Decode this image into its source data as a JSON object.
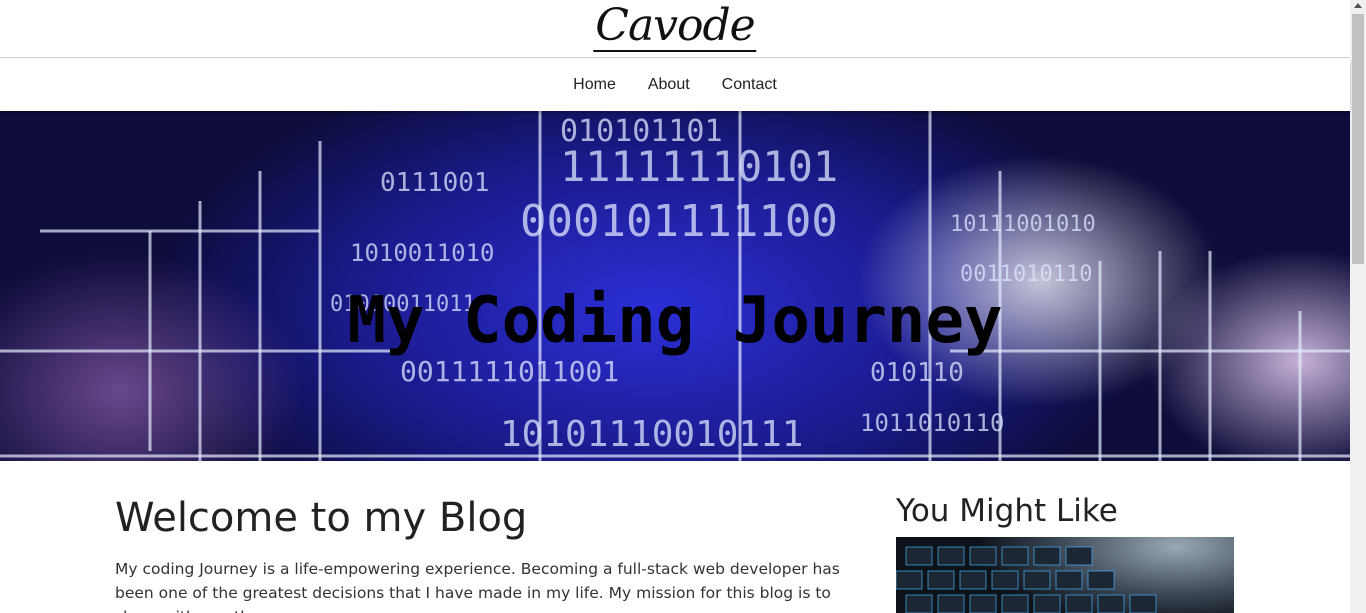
{
  "site": {
    "logo": "Cavode"
  },
  "nav": {
    "items": [
      {
        "label": "Home"
      },
      {
        "label": "About"
      },
      {
        "label": "Contact"
      }
    ]
  },
  "hero": {
    "title": "My Coding Journey"
  },
  "main": {
    "heading": "Welcome to my Blog",
    "intro": "My coding Journey is a life-empowering experience. Becoming a full-stack web developer has been one of the greatest decisions that I have made in my life. My mission for this blog is to share with you the"
  },
  "aside": {
    "heading": "You Might Like"
  },
  "colors": {
    "hero_blue": "#2b2fd6",
    "text": "#222222"
  }
}
